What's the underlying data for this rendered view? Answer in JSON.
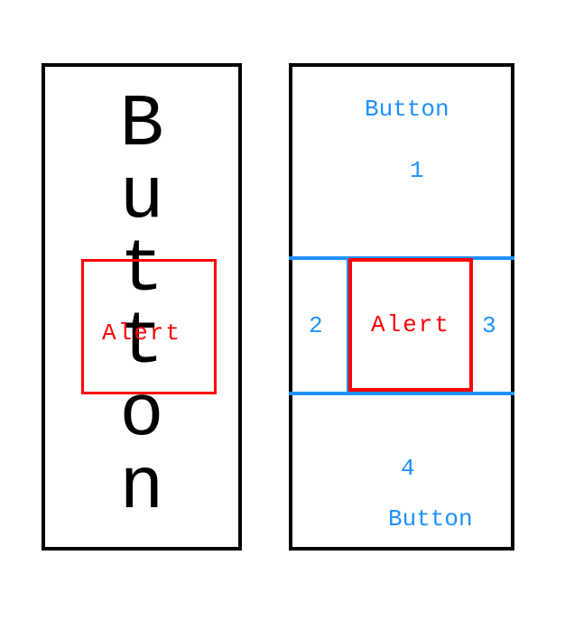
{
  "left": {
    "letters": [
      "B",
      "u",
      "t",
      "t",
      "o",
      "n"
    ],
    "alert": "Alert"
  },
  "right": {
    "button_top": "Button",
    "button_bottom": "Button",
    "region_1": "1",
    "region_2": "2",
    "region_3": "3",
    "region_4": "4",
    "alert": "Alert"
  },
  "colors": {
    "border": "#000000",
    "alert": "#ff0000",
    "accent": "#1e90ff"
  }
}
